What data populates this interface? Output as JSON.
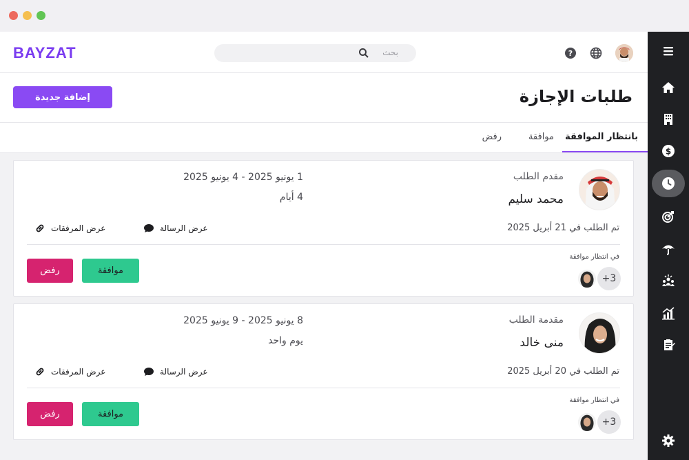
{
  "app": {
    "logo": "BAYZAT"
  },
  "search": {
    "placeholder": "بحث"
  },
  "page": {
    "title": "طلبات الإجازة",
    "add_button": "إضافة جديدة"
  },
  "tabs": [
    {
      "label": "بانتظار الموافقة",
      "active": true
    },
    {
      "label": "موافقة",
      "active": false
    },
    {
      "label": "رفض",
      "active": false
    }
  ],
  "requests": [
    {
      "role": "مقدم الطلب",
      "name": "محمد سليم",
      "dates": "1 يونيو 2025 - 4 يونيو 2025",
      "duration": "4 أيام",
      "requested_on": "تم الطلب في 21 أبريل 2025",
      "view_message": "عرض الرسالة",
      "view_attachments": "عرض المرفقات",
      "pending_label": "في انتظار موافقة",
      "more_approvers": "+3",
      "approve": "موافقة",
      "reject": "رفض"
    },
    {
      "role": "مقدمة الطلب",
      "name": "منى خالد",
      "dates": "8 يونيو 2025 - 9 يونيو 2025",
      "duration": "يوم واحد",
      "requested_on": "تم الطلب في 20 أبريل 2025",
      "view_message": "عرض الرسالة",
      "view_attachments": "عرض المرفقات",
      "pending_label": "في انتظار موافقة",
      "more_approvers": "+3",
      "approve": "موافقة",
      "reject": "رفض"
    }
  ],
  "sidebar": {
    "items": [
      {
        "icon": "menu-icon"
      },
      {
        "icon": "home-icon"
      },
      {
        "icon": "building-icon"
      },
      {
        "icon": "dollar-icon"
      },
      {
        "icon": "clock-icon",
        "active": true
      },
      {
        "icon": "target-icon"
      },
      {
        "icon": "umbrella-icon"
      },
      {
        "icon": "people-icon"
      },
      {
        "icon": "chart-icon"
      },
      {
        "icon": "clipboard-icon"
      },
      {
        "icon": "gear-icon"
      }
    ]
  },
  "colors": {
    "brand": "#7a3cf0",
    "primary_button": "#8a4af3",
    "approve": "#2ec98f",
    "reject": "#d6236f",
    "sidebar": "#1f2023"
  }
}
